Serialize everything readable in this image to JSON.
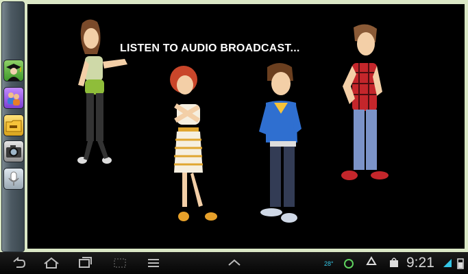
{
  "stage": {
    "headline": "LISTEN TO AUDIO BROADCAST..."
  },
  "sidebar": {
    "items": [
      {
        "name": "graduate",
        "icon": "graduate-icon"
      },
      {
        "name": "users",
        "icon": "users-icon"
      },
      {
        "name": "folder",
        "icon": "folder-icon"
      },
      {
        "name": "camera",
        "icon": "camera-icon"
      },
      {
        "name": "microphone",
        "icon": "microphone-icon"
      }
    ]
  },
  "status_bar": {
    "clock": "9:21",
    "temperature": "28°",
    "icons": [
      "back-icon",
      "home-icon",
      "recent-apps-icon",
      "screenshot-icon",
      "menu-icon",
      "up-chevron-icon",
      "signal-icon",
      "battery-icon"
    ]
  },
  "colors": {
    "frame": "#dbe8c6",
    "stage_bg": "#000000",
    "headline": "#ffffff",
    "clock": "#d7d7d7",
    "accent_blue": "#34c6e6"
  }
}
